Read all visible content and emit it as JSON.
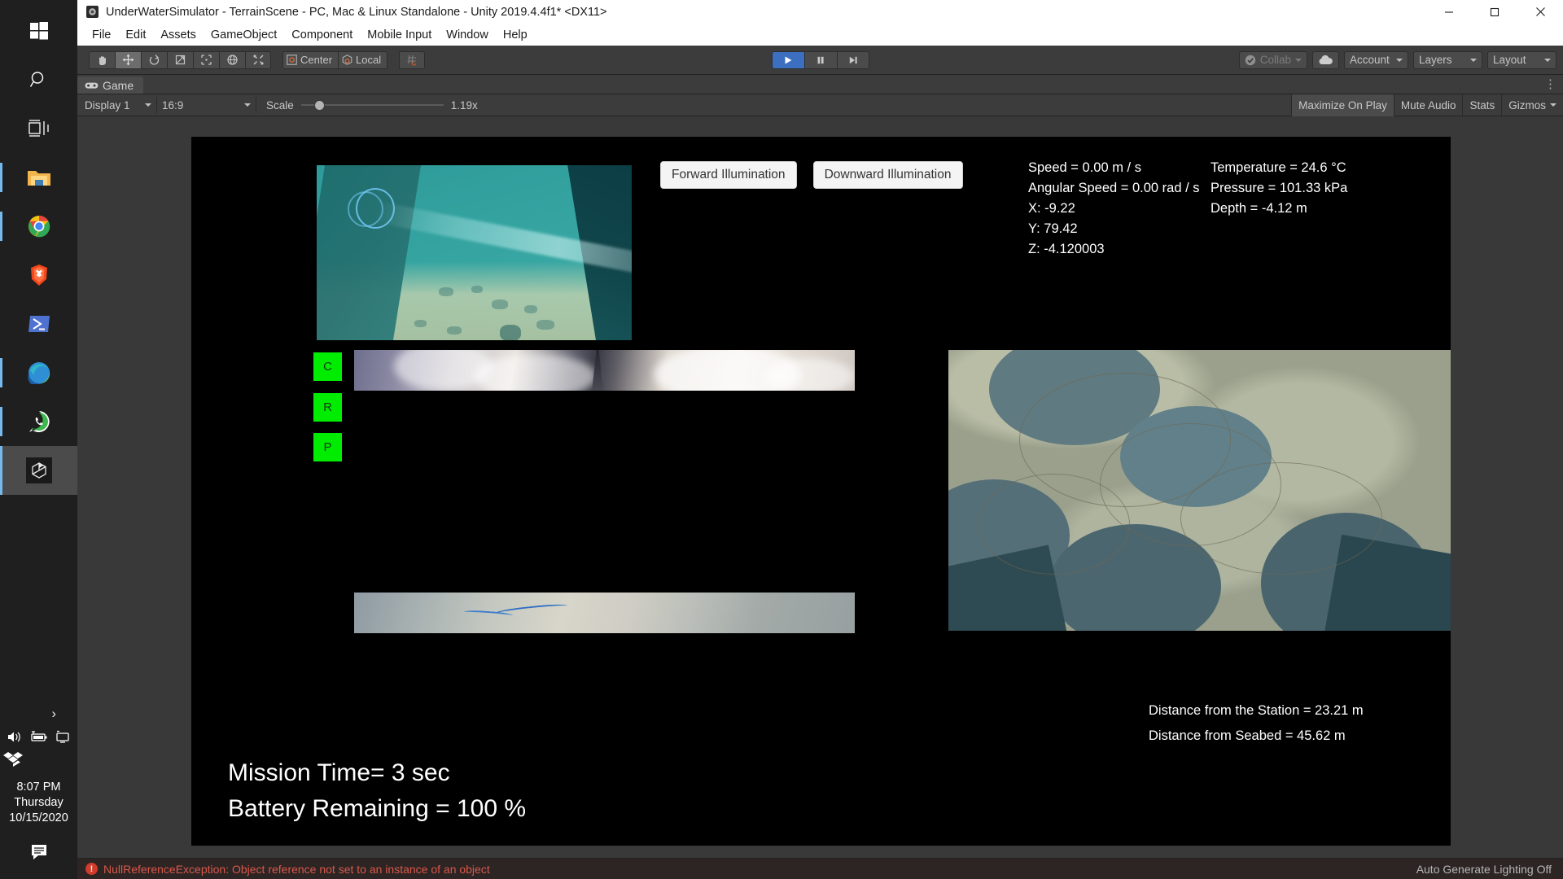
{
  "taskbar": {
    "items": [
      {
        "name": "start-button",
        "icon": "windows-logo-icon"
      },
      {
        "name": "search-button",
        "icon": "search-icon"
      },
      {
        "name": "task-view-button",
        "icon": "task-view-icon"
      },
      {
        "name": "file-explorer",
        "icon": "folder-icon"
      },
      {
        "name": "google-chrome",
        "icon": "chrome-icon"
      },
      {
        "name": "brave-browser",
        "icon": "brave-lion-icon"
      },
      {
        "name": "windows-powershell",
        "icon": "powershell-icon"
      },
      {
        "name": "microsoft-edge",
        "icon": "edge-icon"
      },
      {
        "name": "whatsapp",
        "icon": "whatsapp-icon"
      },
      {
        "name": "unity-editor",
        "icon": "unity-icon"
      }
    ],
    "tray": {
      "chevron": "›",
      "icons": [
        "volume-icon",
        "battery-icon",
        "network-icon",
        "dropbox-icon"
      ],
      "time": "8:07 PM",
      "day": "Thursday",
      "date": "10/15/2020",
      "notification": "notification-icon"
    }
  },
  "window": {
    "title": "UnderWaterSimulator - TerrainScene - PC, Mac & Linux Standalone - Unity 2019.4.4f1* <DX11>",
    "controls": {
      "minimize": "─",
      "maximize": "□",
      "close": "✕"
    }
  },
  "menubar": {
    "items": [
      "File",
      "Edit",
      "Assets",
      "GameObject",
      "Component",
      "Mobile Input",
      "Window",
      "Help"
    ]
  },
  "toolbar": {
    "transform_tools": [
      {
        "name": "hand-tool",
        "icon": "hand-icon",
        "selected": false
      },
      {
        "name": "move-tool",
        "icon": "move-arrows-icon",
        "selected": true
      },
      {
        "name": "rotate-tool",
        "icon": "rotate-icon",
        "selected": false
      },
      {
        "name": "scale-tool",
        "icon": "scale-icon",
        "selected": false
      },
      {
        "name": "rect-tool",
        "icon": "rect-transform-icon",
        "selected": false
      },
      {
        "name": "transform-tool",
        "icon": "transform-combined-icon",
        "selected": false
      },
      {
        "name": "custom-editor-tool",
        "icon": "wrench-icon",
        "selected": false
      }
    ],
    "pivot_label": "Center",
    "pivot_rotation_label": "Local",
    "snap_icon": "grid-snap-icon",
    "play_controls": {
      "play": "play-icon",
      "pause": "pause-icon",
      "step": "step-icon",
      "is_playing": true
    },
    "collab_label": "Collab",
    "cloud_icon": "cloud-icon",
    "account_label": "Account",
    "layers_label": "Layers",
    "layout_label": "Layout",
    "overflow_dots": "⋮"
  },
  "game_tab": {
    "label": "Game",
    "icon": "game-controller-icon",
    "menu_dots": "⋮"
  },
  "game_toolbar": {
    "display_label": "Display 1",
    "aspect_label": "16:9",
    "scale_label": "Scale",
    "scale_value": "1.19x",
    "maximize_on_play": "Maximize On Play",
    "mute_audio": "Mute Audio",
    "stats": "Stats",
    "gizmos": "Gizmos"
  },
  "game_view": {
    "buttons": [
      {
        "name": "forward-illumination-button",
        "label": "Forward Illumination"
      },
      {
        "name": "downward-illumination-button",
        "label": "Downward Illumination"
      }
    ],
    "indicators": [
      {
        "name": "indicator-c",
        "label": "C",
        "color": "#00ec00"
      },
      {
        "name": "indicator-r",
        "label": "R",
        "color": "#00ec00"
      },
      {
        "name": "indicator-p",
        "label": "P",
        "color": "#00ec00"
      }
    ],
    "telemetry_left": [
      "Speed = 0.00 m / s",
      "Angular Speed = 0.00 rad / s",
      "X: -9.22",
      "Y: 79.42",
      "Z: -4.120003"
    ],
    "telemetry_right": [
      "Temperature = 24.6 °C",
      "Pressure = 101.33 kPa",
      "Depth = -4.12 m"
    ],
    "distances": [
      "Distance from the Station = 23.21 m",
      "Distance from Seabed = 45.62 m"
    ],
    "mission": [
      "Mission Time= 3 sec",
      "Battery Remaining = 100 %"
    ]
  },
  "statusbar": {
    "error_icon": "error-icon",
    "error_text": "NullReferenceException: Object reference not set to an instance of an object",
    "lighting_text": "Auto Generate Lighting Off"
  },
  "colors": {
    "unity_bg": "#383838",
    "toolbar_bg": "#3c3c3c",
    "play_active": "#3c6fbf",
    "indicator_green": "#00ec00",
    "error_red": "#d8594a",
    "taskbar_bg": "#1f1f1f"
  }
}
